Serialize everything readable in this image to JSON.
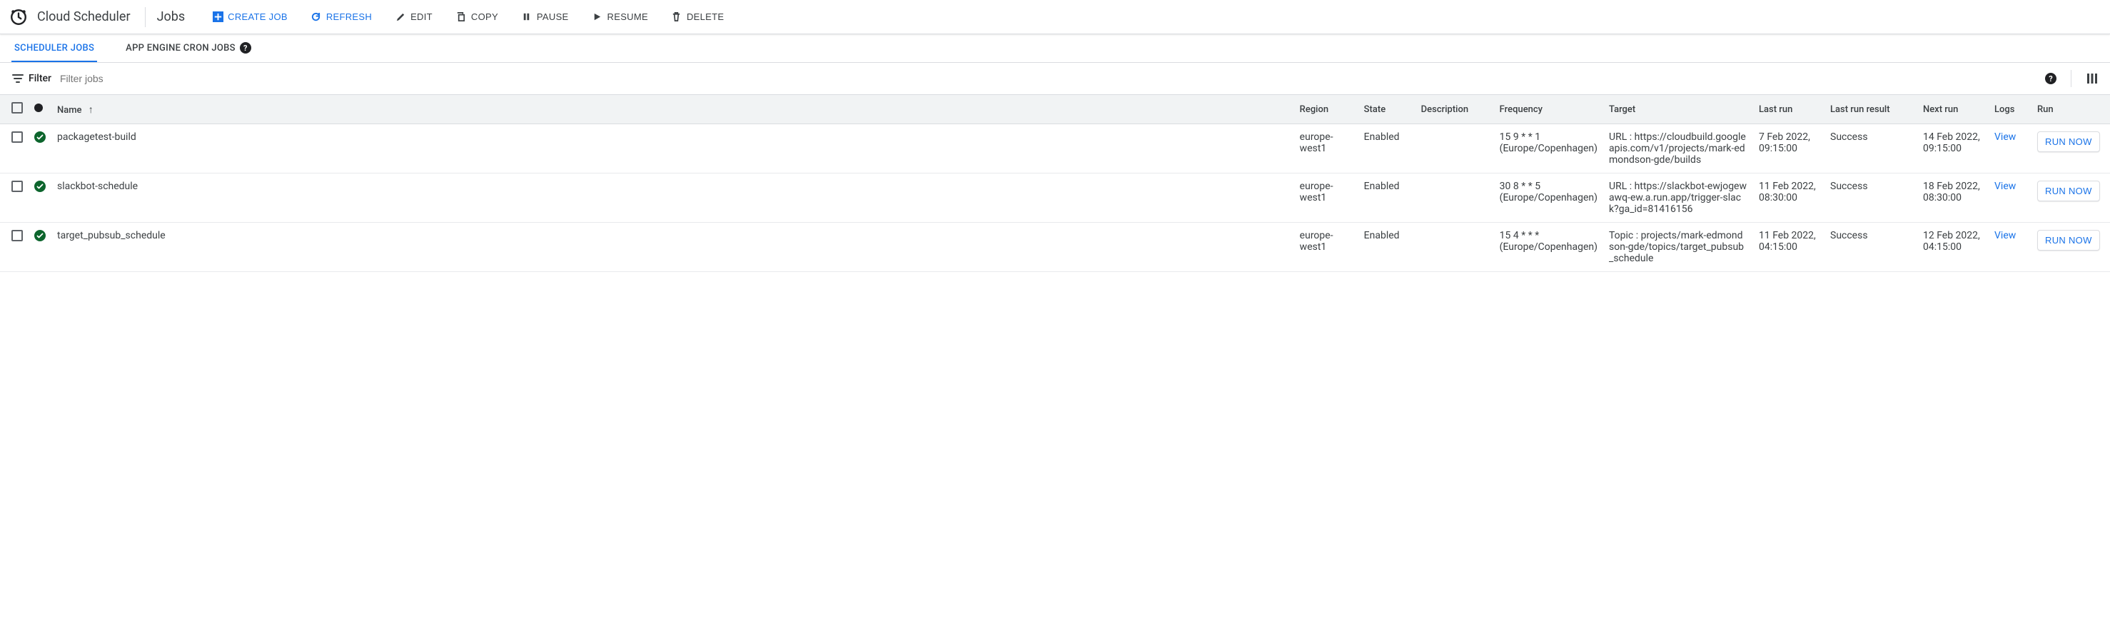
{
  "header": {
    "product": "Cloud Scheduler",
    "page": "Jobs",
    "buttons": {
      "create": "CREATE JOB",
      "refresh": "REFRESH",
      "edit": "EDIT",
      "copy": "COPY",
      "pause": "PAUSE",
      "resume": "RESUME",
      "delete": "DELETE"
    }
  },
  "tabs": {
    "scheduler": "SCHEDULER JOBS",
    "cron": "APP ENGINE CRON JOBS"
  },
  "filter": {
    "label": "Filter",
    "placeholder": "Filter jobs"
  },
  "columns": {
    "name": "Name",
    "region": "Region",
    "state": "State",
    "description": "Description",
    "frequency": "Frequency",
    "target": "Target",
    "last_run": "Last run",
    "last_result": "Last run result",
    "next_run": "Next run",
    "logs": "Logs",
    "run": "Run"
  },
  "run_now_label": "RUN NOW",
  "view_label": "View",
  "jobs": [
    {
      "name": "packagetest-build",
      "region": "europe-west1",
      "state": "Enabled",
      "description": "",
      "frequency": "15 9 * * 1 (Europe/Copenhagen)",
      "target": "URL : https://cloudbuild.googleapis.com/v1/projects/mark-edmondson-gde/builds",
      "last_run": "7 Feb 2022, 09:15:00",
      "last_result": "Success",
      "next_run": "14 Feb 2022, 09:15:00"
    },
    {
      "name": "slackbot-schedule",
      "region": "europe-west1",
      "state": "Enabled",
      "description": "",
      "frequency": "30 8 * * 5 (Europe/Copenhagen)",
      "target": "URL : https://slackbot-ewjogewawq-ew.a.run.app/trigger-slack?ga_id=81416156",
      "last_run": "11 Feb 2022, 08:30:00",
      "last_result": "Success",
      "next_run": "18 Feb 2022, 08:30:00"
    },
    {
      "name": "target_pubsub_schedule",
      "region": "europe-west1",
      "state": "Enabled",
      "description": "",
      "frequency": "15 4 * * * (Europe/Copenhagen)",
      "target": "Topic : projects/mark-edmondson-gde/topics/target_pubsub_schedule",
      "last_run": "11 Feb 2022, 04:15:00",
      "last_result": "Success",
      "next_run": "12 Feb 2022, 04:15:00"
    }
  ]
}
